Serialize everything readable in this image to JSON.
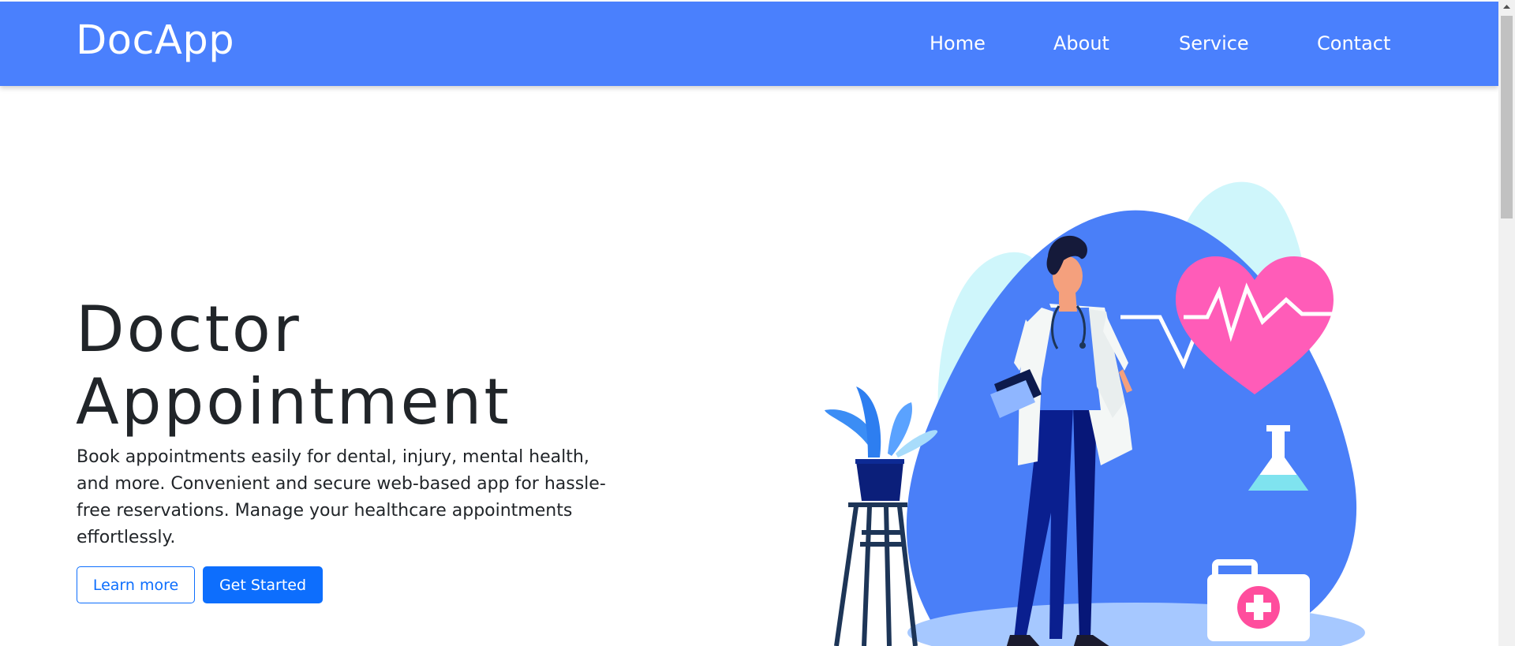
{
  "nav": {
    "brand": "DocApp",
    "links": [
      {
        "label": "Home"
      },
      {
        "label": "About"
      },
      {
        "label": "Service"
      },
      {
        "label": "Contact"
      }
    ]
  },
  "hero": {
    "title_line1": "Doctor",
    "title_line2": "Appointment",
    "description": "Book appointments easily for dental, injury, mental health, and more. Convenient and secure web-based app for hassle-free reservations. Manage your healthcare appointments effortlessly.",
    "learn_more_label": "Learn more",
    "get_started_label": "Get Started"
  },
  "colors": {
    "navbar": "#4a80fd",
    "primary_button": "#0d6efd",
    "illustration_blob": "#4a7ff8",
    "heart": "#ff5cb8"
  },
  "icons": [
    "doctor-illustration",
    "heart-icon",
    "flask-icon",
    "first-aid-kit-icon",
    "potted-plant-icon"
  ]
}
